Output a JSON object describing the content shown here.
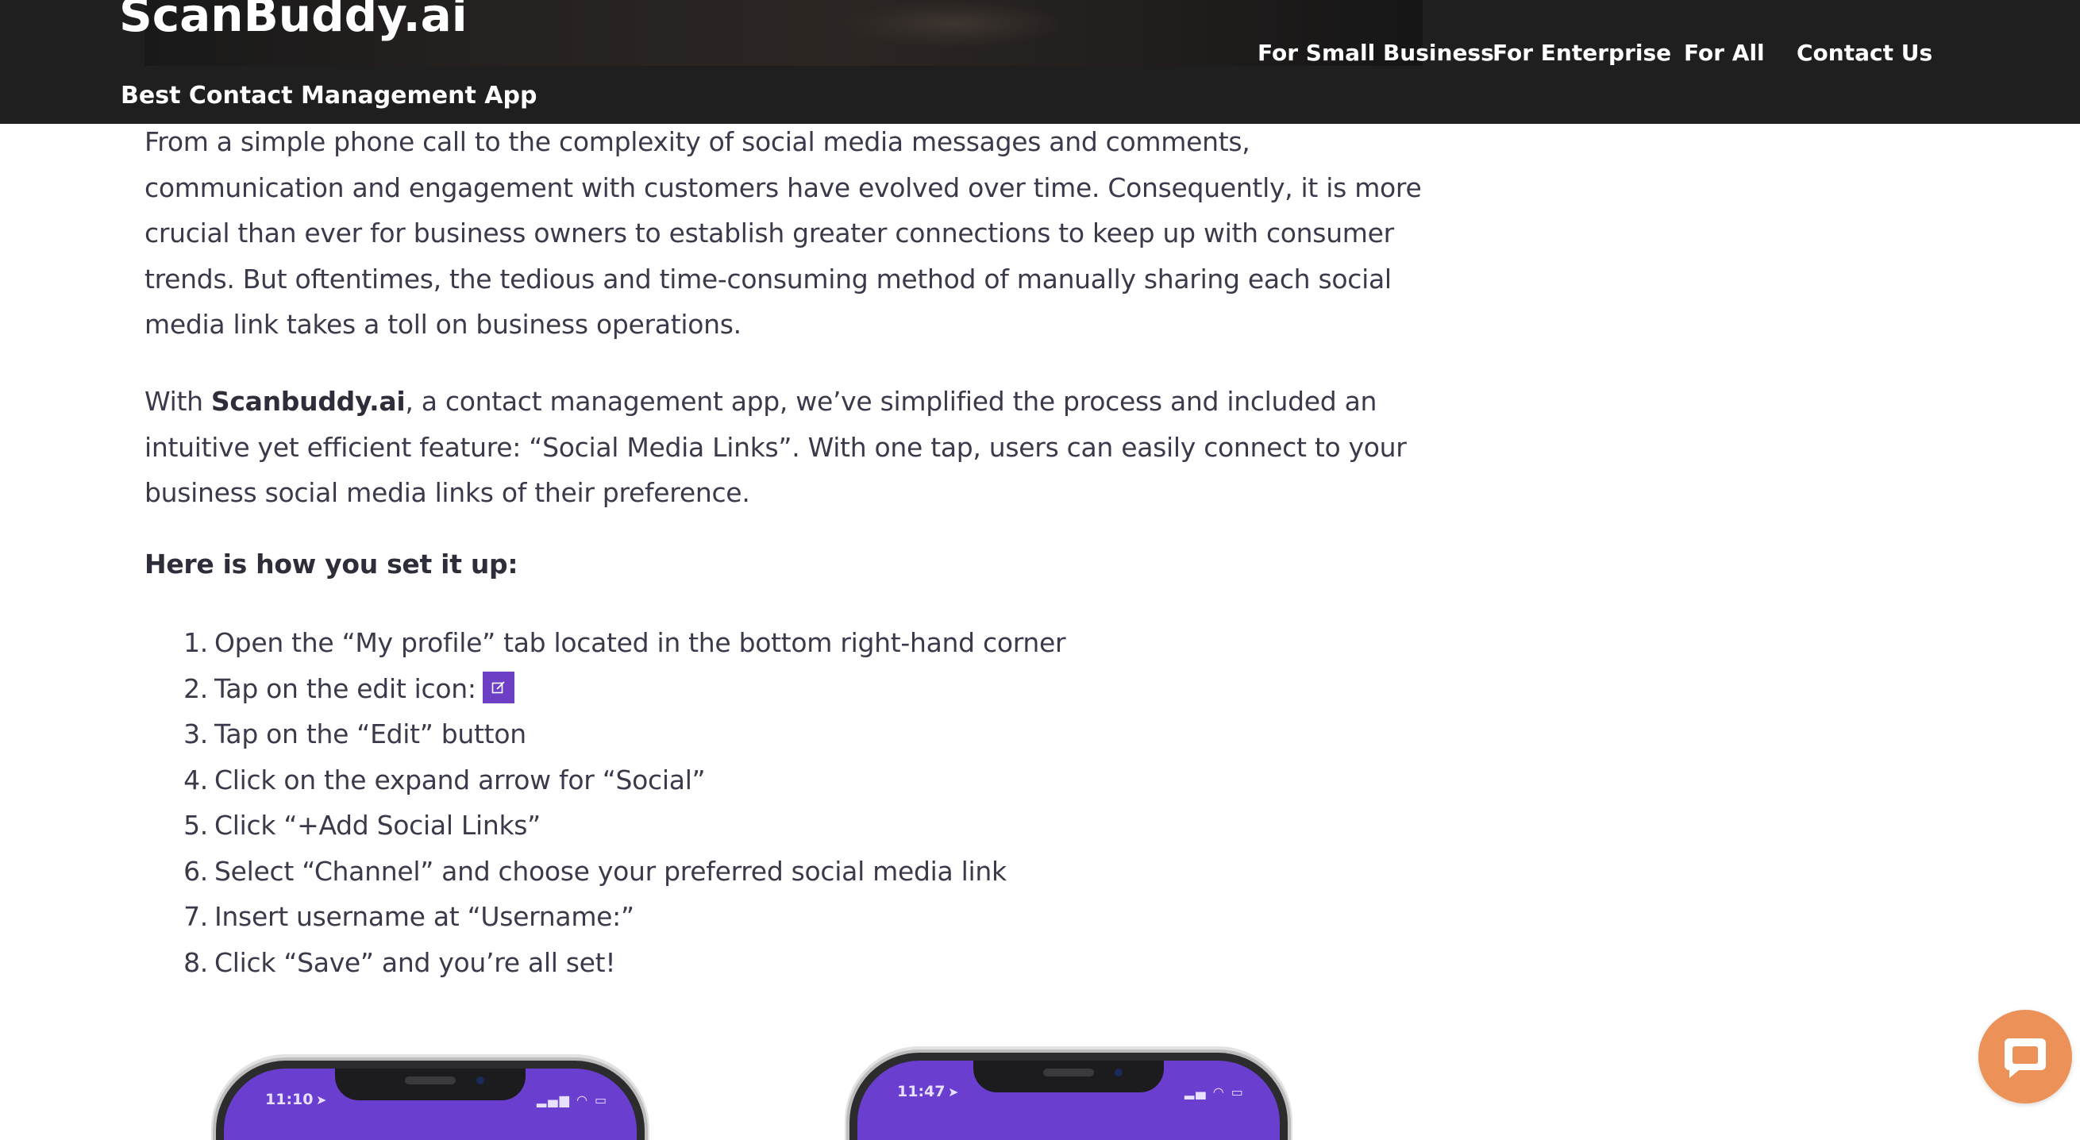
{
  "header": {
    "logo_text": "ScanBuddy.ai",
    "tagline": "Best Contact Management App",
    "nav": [
      {
        "label": "For Small Business"
      },
      {
        "label": "For Enterprise"
      },
      {
        "label": "For All"
      },
      {
        "label": "Contact Us"
      }
    ]
  },
  "article": {
    "intro_lines": [
      "From a simple phone call to the complexity of social media messages and comments,",
      "communication and engagement with customers have evolved over time. Consequently, it is more",
      "crucial than ever for business owners to establish greater connections to keep up with consumer",
      "trends. But oftentimes, the tedious and time-consuming method of manually sharing each social",
      "media link takes a toll on business operations."
    ],
    "feature_prefix": "With ",
    "feature_brand": "Scanbuddy.ai",
    "feature_line1_rest": ", a contact management app, we’ve simplified the process and included an",
    "feature_line2": "intuitive yet efficient feature: “Social Media Links”. With one tap, users can easily connect to your",
    "feature_line3": "business social media links of their preference.",
    "setup_heading": "Here is how you set it up:",
    "steps": [
      {
        "num": "1.",
        "text": "Open the “My profile” tab located in the bottom right-hand corner"
      },
      {
        "num": "2.",
        "text": "Tap on the edit icon:"
      },
      {
        "num": "3.",
        "text": "Tap on the “Edit” button"
      },
      {
        "num": "4.",
        "text": "Click on the expand arrow for “Social”"
      },
      {
        "num": "5.",
        "text": "Click “+Add Social Links”"
      },
      {
        "num": "6.",
        "text": "Select “Channel” and choose your preferred social media link"
      },
      {
        "num": "7.",
        "text": "Insert username at “Username:”"
      },
      {
        "num": "8.",
        "text": "Click “Save” and you’re all set!"
      }
    ]
  },
  "phones": [
    {
      "time": "11:10",
      "status": "▂▄▆ ◠ ▭"
    },
    {
      "time": "11:47",
      "status": "▂▄ ◠ ▭"
    }
  ],
  "colors": {
    "header_bg": "#1f1f1f",
    "edit_icon_bg": "#6c3fc4",
    "phone_screen": "#6a3fd0",
    "chat_button": "#ec9258"
  },
  "icons": {
    "edit": "edit-icon",
    "chat": "chat-bubble-icon",
    "location": "location-arrow-icon"
  }
}
